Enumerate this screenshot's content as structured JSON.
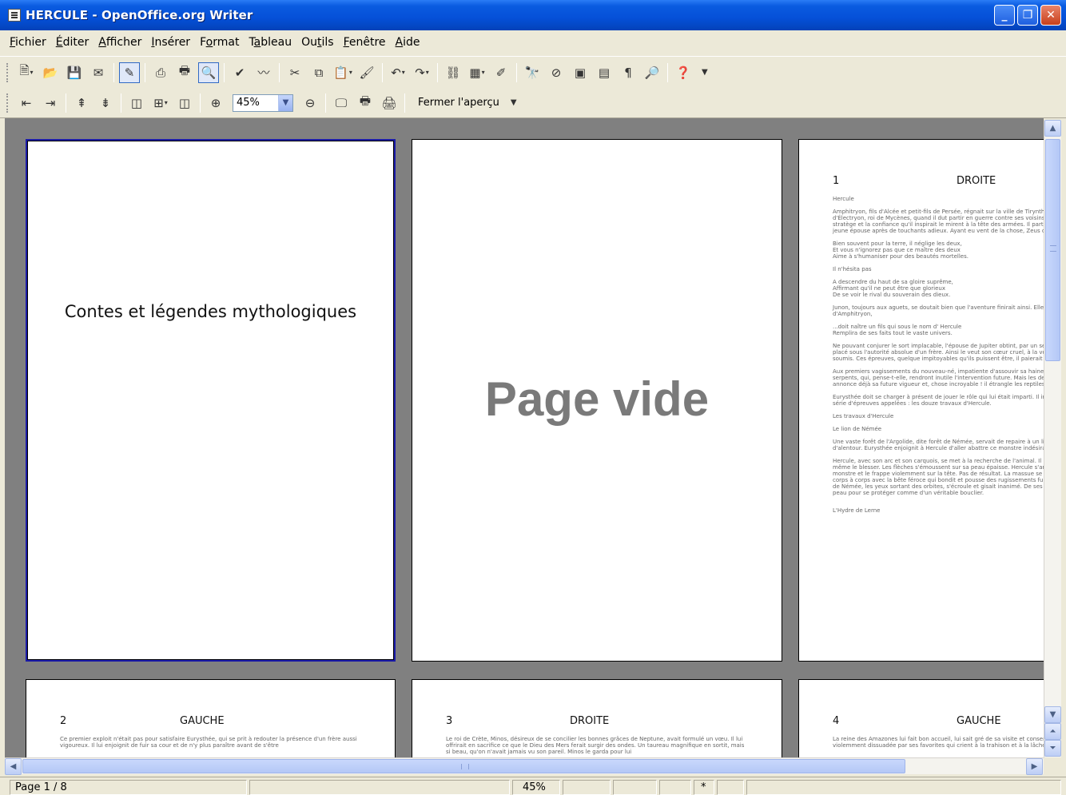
{
  "window": {
    "title": "HERCULE - OpenOffice.org Writer",
    "app_icon": "writer-document-icon",
    "controls": [
      "minimize-icon",
      "maximize-icon",
      "close-icon"
    ]
  },
  "menu": [
    {
      "pre": "",
      "key": "F",
      "post": "ichier"
    },
    {
      "pre": "",
      "key": "É",
      "post": "diter"
    },
    {
      "pre": "",
      "key": "A",
      "post": "fficher"
    },
    {
      "pre": "",
      "key": "I",
      "post": "nsérer"
    },
    {
      "pre": "F",
      "key": "o",
      "post": "rmat"
    },
    {
      "pre": "T",
      "key": "a",
      "post": "bleau"
    },
    {
      "pre": "Ou",
      "key": "t",
      "post": "ils"
    },
    {
      "pre": "",
      "key": "F",
      "post": "enêtre"
    },
    {
      "pre": "",
      "key": "A",
      "post": "ide"
    }
  ],
  "preview_toolbar": {
    "zoom_value": "45%",
    "close_label": "Fermer l'aperçu"
  },
  "pages": {
    "cover_title": "Contes et légendes mythologiques",
    "blank_label": "Page vide",
    "page3": {
      "number": "1",
      "side": "DROITE",
      "paragraphs": [
        "Hercule",
        "Amphitryon, fils d'Alcée et petit-fils de Persée, régnait sur la ville de Tirynthe. Il venait d'épouser la belle Alcmène, fille d'Électryon, roi de Mycènes, quand il dut partir en guerre contre ses voisins les Théléboéens. Sa renommée d'habile stratège et la confiance qu'il inspirait le mirent à la tête des armées. Il partit plein d'ardeur et de courage, laissant sa jeune épouse après de touchants adieux. Ayant eu vent de la chose, Zeus décida d'en profiter pour courtiser Alcmène.",
        "Bien souvent pour la terre, il néglige les deux,\nEt vous n'ignorez pas que ce maître des deux\nAime à s'humaniser pour des beautés mortelles.",
        "Il n'hésita pas",
        "A descendre du haut de sa gloire suprême,\nAffirmant qu'il ne peut être que glorieux\nDe se voir le rival du souverain des dieux.",
        "Junon, toujours aux aguets, se doutait bien que l'aventure finirait ainsi. Elle apprend en effet qu'en la maison d'Amphitryon,",
        "...doit naître un fils qui sous le nom d' Hercule\nRemplira de ses faits tout le vaste univers.",
        "Ne pouvant conjurer le sort implacable, l'épouse de Jupiter obtint, par un serment habile, que l'enfant à naître serait placé sous l'autorité absolue d'un frère. Ainsi le veut son cœur cruel, à la volonté duquel il serait inexorablement soumis. Ces épreuves, quelque impitoyables qu'ils puissent être, il paierait chèrement la grâce divine.",
        "Aux premiers vagissements du nouveau-né, impatiente d'assouvir sa haine, Junon glisse dans son berceau deux serpents, qui, pense-t-elle, rendront inutile l'intervention future. Mais les destins se réaliseront malgré elle. Hercule annonce déjà sa future vigueur et, chose incroyable ! il étrangle les reptiles de ses mains menues.",
        "Eurysthée doit se charger à présent de jouer le rôle qui lui était imparti. Il imposa au fils de Jupiter et d'Alcmène une série d'épreuves appelées : les douze travaux d'Hercule.",
        "Les travaux d'Hercule",
        "Le lion de Némée",
        "Une vaste forêt de l'Argolide, dite forêt de Némée, servait de repaire à un lion redoutable. Il dévorait les troupeaux d'alentour. Eurysthée enjoignit à Hercule d'aller abattre ce monstre indésirable.",
        "Hercule, avec son arc et son carquois, se met à la recherche de l'animal. Il lui décoche trait sur trait sans pouvoir même le blesser. Les flèches s'émoussent sur sa peau épaisse. Hercule s'arme alors d'une énorme massue, pousse au monstre et le frappe violemment sur la tête. Pas de résultat. La massue se brise en deux. Il n'y a plus qu'une solution : corps à corps avec la bête féroce qui bondit et pousse des rugissements furieux. Au bout de quelques instants, le lion de Némée, les yeux sortant des orbites, s'écroule et gisait inanimé. De ses ongles, Hercule le dépèce et se revêt de sa peau pour se protéger comme d'un véritable bouclier.",
        "L'Hydre de Lerne"
      ]
    },
    "page4": {
      "number": "2",
      "side": "GAUCHE",
      "text": "Ce premier exploit n'était pas pour satisfaire Eurysthée, qui se prit à redouter la présence d'un frère aussi vigoureux. Il lui enjoignit de fuir sa cour et de n'y plus paraître avant de s'être"
    },
    "page5": {
      "number": "3",
      "side": "DROITE",
      "text": "Le roi de Crète, Minos, désireux de se concilier les bonnes grâces de Neptune, avait formulé un vœu. Il lui offrirait en sacrifice ce que le Dieu des Mers ferait surgir des ondes. Un taureau magnifique en sortit, mais si beau, qu'on n'avait jamais vu son pareil. Minos le garda pour lui"
    },
    "page6": {
      "number": "4",
      "side": "GAUCHE",
      "text": "La reine des Amazones lui fait bon accueil, lui sait gré de sa visite et consent même à lui remettre la ceinture, en est violemment dissuadée par ses favorites qui crient à la trahison et à la lâcheté."
    }
  },
  "status": {
    "page": "Page 1 / 8",
    "zoom": "45%",
    "modified": "*"
  }
}
